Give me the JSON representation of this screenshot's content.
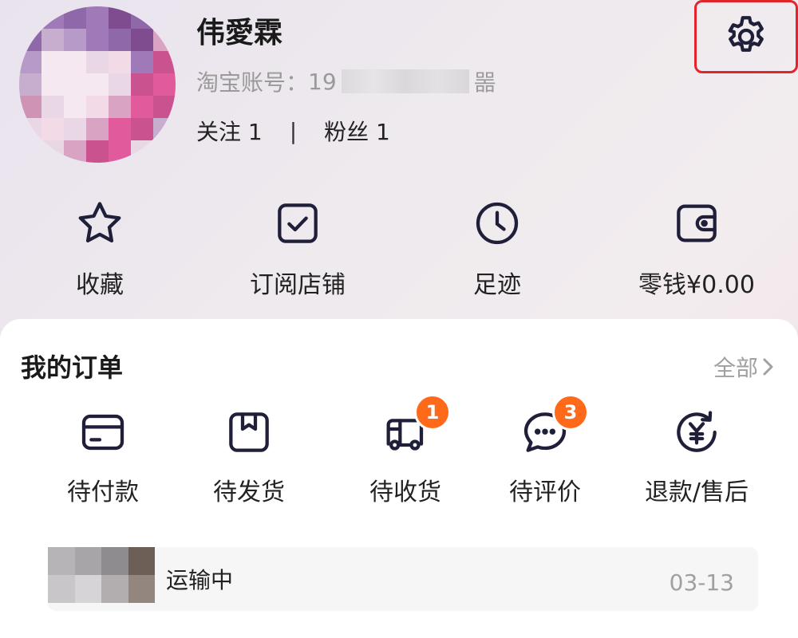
{
  "profile": {
    "username": "伟愛霖",
    "account_label": "淘宝账号：",
    "account_prefix": "19",
    "account_suffix": "噐",
    "following_label": "关注 1",
    "followers_label": "粉丝 1"
  },
  "quick_actions": [
    {
      "label": "收藏",
      "icon": "star-icon"
    },
    {
      "label": "订阅店铺",
      "icon": "subscribe-check-icon"
    },
    {
      "label": "足迹",
      "icon": "clock-icon"
    },
    {
      "label": "零钱¥0.00",
      "icon": "wallet-icon"
    }
  ],
  "orders": {
    "title": "我的订单",
    "all_label": "全部",
    "items": [
      {
        "label": "待付款",
        "icon": "card-icon"
      },
      {
        "label": "待发货",
        "icon": "box-icon"
      },
      {
        "label": "待收货",
        "icon": "truck-icon",
        "badge": "1"
      },
      {
        "label": "待评价",
        "icon": "chat-icon",
        "badge": "3"
      },
      {
        "label": "退款/售后",
        "icon": "refund-icon"
      }
    ]
  },
  "shipment": {
    "status": "运输中",
    "date": "03-13"
  },
  "colors": {
    "highlight": "#e0262b",
    "badge": "#ff6a1a",
    "icon_stroke": "#1f1f3a"
  }
}
